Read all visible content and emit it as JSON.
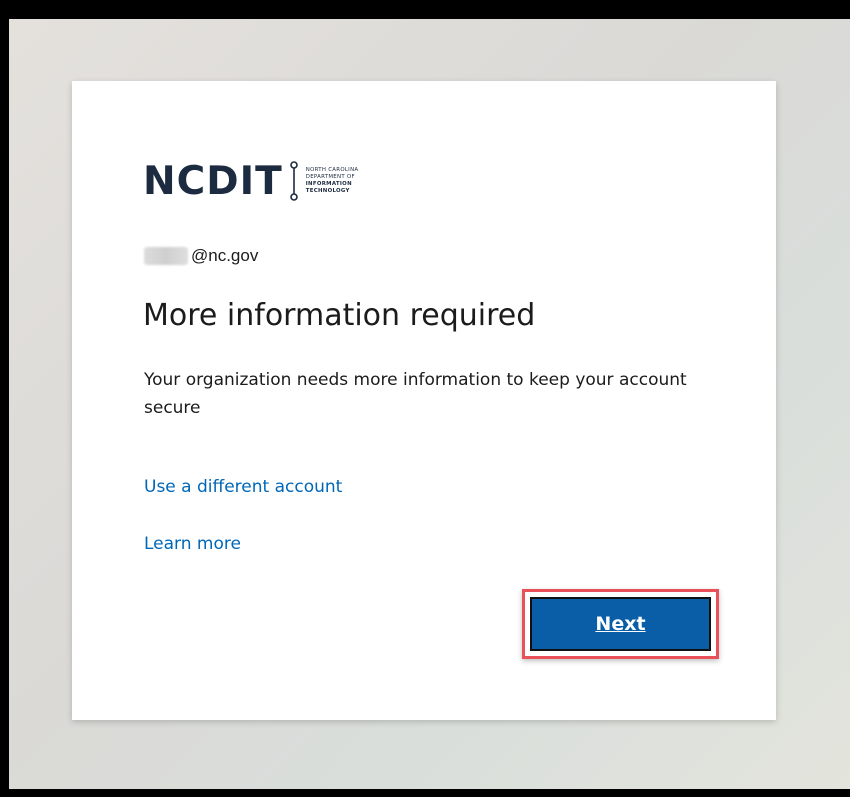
{
  "logo": {
    "wordmark": "NCDIT",
    "sub_lines": [
      "North Carolina",
      "Department of",
      "Information",
      "Technology"
    ],
    "colors": {
      "text": "#1c2b40"
    }
  },
  "account": {
    "email_domain": "@nc.gov"
  },
  "page": {
    "title": "More information required",
    "description": "Your organization needs more information to keep your account secure"
  },
  "links": {
    "different_account": "Use a different account",
    "learn_more": "Learn more"
  },
  "actions": {
    "next_label": "Next"
  },
  "colors": {
    "link": "#0067b8",
    "primary_button": "#0a5ea8",
    "highlight_border": "#e8515a",
    "card_background": "#ffffff",
    "frame": "#000000"
  }
}
